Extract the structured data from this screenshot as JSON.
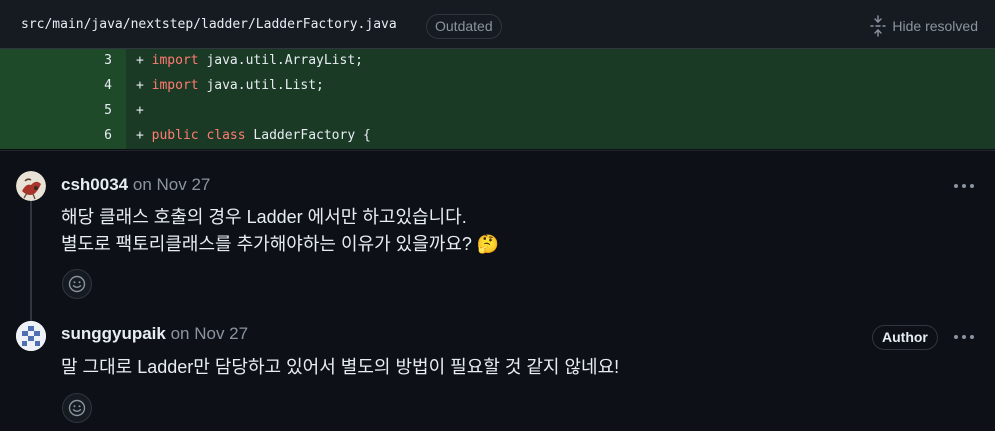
{
  "file": {
    "path": "src/main/java/nextstep/ladder/LadderFactory.java",
    "badge": "Outdated",
    "hide_resolved_label": "Hide resolved",
    "icon": "unfold-icon"
  },
  "diff": {
    "lines": [
      {
        "num": "3",
        "sign": "+",
        "keyword1": "import",
        "keyword2": "",
        "rest": " java.util.ArrayList;"
      },
      {
        "num": "4",
        "sign": "+",
        "keyword1": "import",
        "keyword2": "",
        "rest": " java.util.List;"
      },
      {
        "num": "5",
        "sign": "+",
        "keyword1": "",
        "keyword2": "",
        "rest": ""
      },
      {
        "num": "6",
        "sign": "+",
        "keyword1": "public",
        "keyword2": "class",
        "rest": " LadderFactory {"
      }
    ]
  },
  "comments": [
    {
      "author": "csh0034",
      "date": "on Nov 27",
      "body_lines": [
        "해당 클래스 호출의 경우 Ladder 에서만 하고있습니다.",
        "별도로 팩토리클래스를 추가해야하는 이유가 있을까요? 🤔"
      ],
      "reaction_icon": "smiley-icon",
      "menu_icon": "kebab-horizontal-icon"
    },
    {
      "author": "sunggyupaik",
      "date": "on Nov 27",
      "badge": "Author",
      "body_lines": [
        "말 그대로 Ladder만 담당하고 있어서 별도의 방법이 필요할 것 같지 않네요!"
      ],
      "reaction_icon": "smiley-icon",
      "menu_icon": "kebab-horizontal-icon"
    }
  ],
  "colors": {
    "background": "#0d1117",
    "addition_line": "#1b3a25",
    "addition_gutter": "#1f4a2a",
    "keyword": "#ff7b72"
  }
}
